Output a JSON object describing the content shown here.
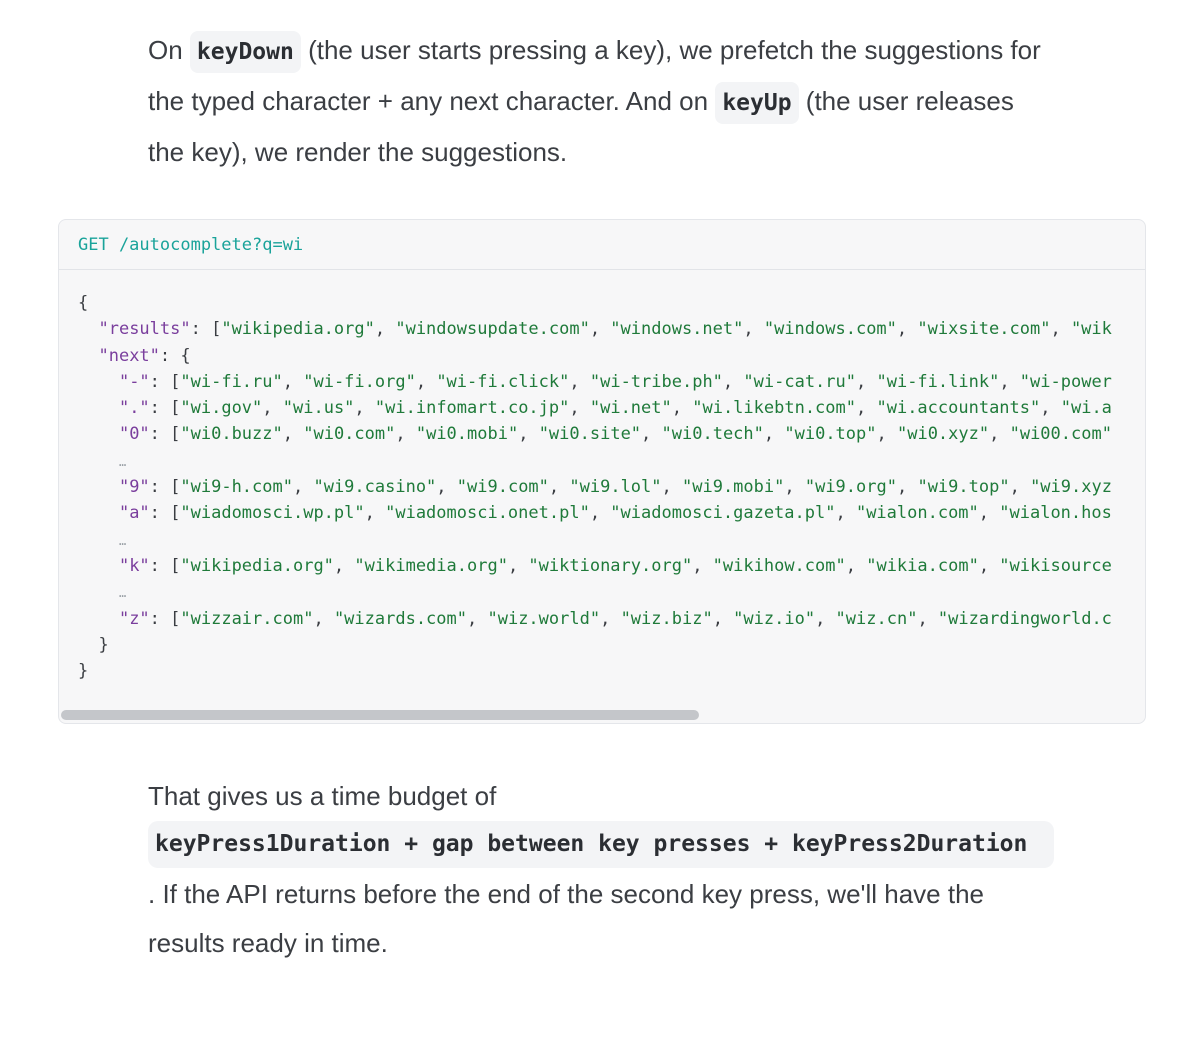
{
  "intro": {
    "t1": "On ",
    "code1": "keyDown",
    "t2": " (the user starts pressing a key), we prefetch the suggestions for the typed character + any next character. And on ",
    "code2": "keyUp",
    "t3": " (the user releases the key), we render the suggestions."
  },
  "code_block": {
    "request": "GET /autocomplete?q=wi",
    "lines": [
      "{",
      "  \"results\": [\"wikipedia.org\", \"windowsupdate.com\", \"windows.net\", \"windows.com\", \"wixsite.com\", \"wik",
      "  \"next\": {",
      "    \"-\": [\"wi-fi.ru\", \"wi-fi.org\", \"wi-fi.click\", \"wi-tribe.ph\", \"wi-cat.ru\", \"wi-fi.link\", \"wi-power",
      "    \".\": [\"wi.gov\", \"wi.us\", \"wi.infomart.co.jp\", \"wi.net\", \"wi.likebtn.com\", \"wi.accountants\", \"wi.a",
      "    \"0\": [\"wi0.buzz\", \"wi0.com\", \"wi0.mobi\", \"wi0.site\", \"wi0.tech\", \"wi0.top\", \"wi0.xyz\", \"wi00.com\"",
      "    …",
      "    \"9\": [\"wi9-h.com\", \"wi9.casino\", \"wi9.com\", \"wi9.lol\", \"wi9.mobi\", \"wi9.org\", \"wi9.top\", \"wi9.xyz",
      "    \"a\": [\"wiadomosci.wp.pl\", \"wiadomosci.onet.pl\", \"wiadomosci.gazeta.pl\", \"wialon.com\", \"wialon.hos",
      "    …",
      "    \"k\": [\"wikipedia.org\", \"wikimedia.org\", \"wiktionary.org\", \"wikihow.com\", \"wikia.com\", \"wikisource",
      "    …",
      "    \"z\": [\"wizzair.com\", \"wizards.com\", \"wiz.world\", \"wiz.biz\", \"wiz.io\", \"wiz.cn\", \"wizardingworld.c",
      "  }",
      "}"
    ]
  },
  "outro": {
    "t1": "That gives us a time budget of",
    "code": "keyPress1Duration + gap between key presses + keyPress2Duration",
    "t2": ". If the API returns before the end of the second key press, we'll have the results ready in time."
  }
}
